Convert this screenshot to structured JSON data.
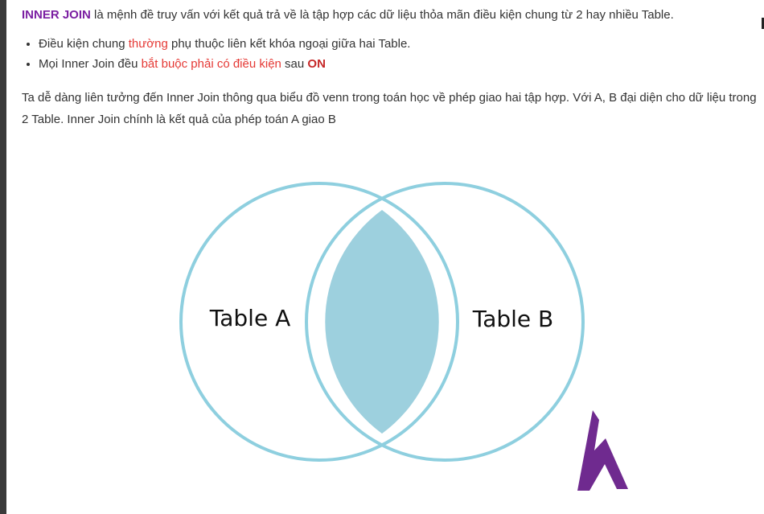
{
  "intro": {
    "keyword": "INNER JOIN",
    "text": " là mệnh đề truy vấn với kết quả trả về là tập hợp các dữ liệu thỏa mãn điều kiện chung từ 2 hay nhiều Table."
  },
  "bullets": [
    {
      "before": "Điều kiện chung ",
      "highlight": "thường",
      "after": " phụ thuộc liên kết khóa ngoại giữa hai Table."
    },
    {
      "before": "Mọi Inner Join đều ",
      "highlight": "bắt buộc phải có điều kiện",
      "middle": " sau ",
      "keyword": "ON"
    }
  ],
  "paragraph": "Ta dễ dàng liên tưởng đến Inner Join thông qua biểu đồ venn trong toán học về phép giao hai tập hợp. Với A, B đại diện cho dữ liệu trong 2 Table. Inner Join chính là kết quả của phép toán A giao B",
  "venn": {
    "left_label": "Table A",
    "right_label": "Table B",
    "stroke_color": "#8ecfdf",
    "intersection_color": "#9dd0de"
  },
  "logo": {
    "letter": "h",
    "color": "#6f2a8f"
  }
}
